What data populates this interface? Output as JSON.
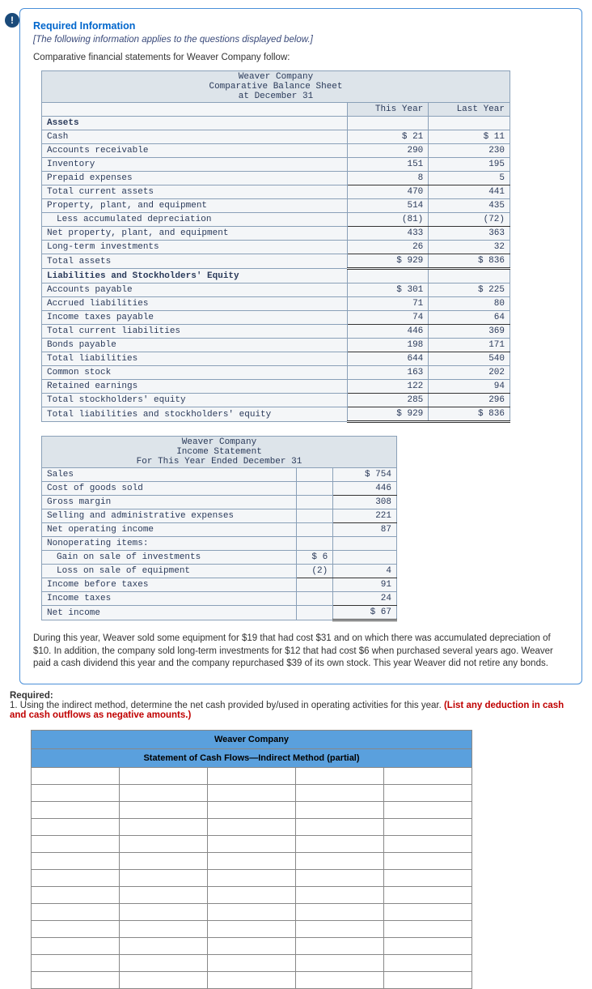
{
  "alert_glyph": "!",
  "card": {
    "heading": "Required Information",
    "note": "[The following information applies to the questions displayed below.]",
    "intro": "Comparative financial statements for Weaver Company follow:",
    "bs_header1": "Weaver Company",
    "bs_header2": "Comparative Balance Sheet",
    "bs_header3": "at December 31",
    "col_this": "This Year",
    "col_last": "Last Year",
    "bs_rows": [
      {
        "label": "Assets",
        "t": "",
        "l": "",
        "cls": "section"
      },
      {
        "label": "Cash",
        "t": "$ 21",
        "l": "$ 11"
      },
      {
        "label": "Accounts receivable",
        "t": "290",
        "l": "230"
      },
      {
        "label": "Inventory",
        "t": "151",
        "l": "195"
      },
      {
        "label": "Prepaid expenses",
        "t": "8",
        "l": "5",
        "cls": "underline"
      },
      {
        "label": "Total current assets",
        "t": "470",
        "l": "441"
      },
      {
        "label": "Property, plant, and equipment",
        "t": "514",
        "l": "435"
      },
      {
        "label": "Less accumulated depreciation",
        "t": "(81)",
        "l": "(72)",
        "indent": true,
        "cls": "underline"
      },
      {
        "label": "Net property, plant, and equipment",
        "t": "433",
        "l": "363"
      },
      {
        "label": "Long-term investments",
        "t": "26",
        "l": "32",
        "cls": "underline"
      },
      {
        "label": "Total assets",
        "t": "$ 929",
        "l": "$ 836",
        "cls": "dbl"
      },
      {
        "label": "Liabilities and Stockholders' Equity",
        "t": "",
        "l": "",
        "cls": "section"
      },
      {
        "label": "Accounts payable",
        "t": "$ 301",
        "l": "$ 225"
      },
      {
        "label": "Accrued liabilities",
        "t": "71",
        "l": "80"
      },
      {
        "label": "Income taxes payable",
        "t": "74",
        "l": "64",
        "cls": "underline"
      },
      {
        "label": "Total current liabilities",
        "t": "446",
        "l": "369"
      },
      {
        "label": "Bonds payable",
        "t": "198",
        "l": "171",
        "cls": "underline"
      },
      {
        "label": "Total liabilities",
        "t": "644",
        "l": "540"
      },
      {
        "label": "Common stock",
        "t": "163",
        "l": "202"
      },
      {
        "label": "Retained earnings",
        "t": "122",
        "l": "94",
        "cls": "underline"
      },
      {
        "label": "Total stockholders' equity",
        "t": "285",
        "l": "296",
        "cls": "underline"
      },
      {
        "label": "Total liabilities and stockholders' equity",
        "t": "$ 929",
        "l": "$ 836",
        "cls": "dbl"
      }
    ],
    "is_header1": "Weaver Company",
    "is_header2": "Income Statement",
    "is_header3": "For This Year Ended December 31",
    "is_rows": [
      {
        "label": "Sales",
        "p": "",
        "v": "$ 754"
      },
      {
        "label": "Cost of goods sold",
        "p": "",
        "v": "446",
        "cls": "underline"
      },
      {
        "label": "Gross margin",
        "p": "",
        "v": "308"
      },
      {
        "label": "Selling and administrative expenses",
        "p": "",
        "v": "221",
        "cls": "underline"
      },
      {
        "label": "Net operating income",
        "p": "",
        "v": "87"
      },
      {
        "label": "Nonoperating items:",
        "p": "",
        "v": ""
      },
      {
        "label": "Gain on sale of investments",
        "p": "$ 6",
        "v": "",
        "indent": true
      },
      {
        "label": "Loss on sale of equipment",
        "p": "(2)",
        "v": "4",
        "indent": true,
        "cls": "underline-pre"
      },
      {
        "label": "Income before taxes",
        "p": "",
        "v": "91"
      },
      {
        "label": "Income taxes",
        "p": "",
        "v": "24",
        "cls": "underline"
      },
      {
        "label": "Net income",
        "p": "",
        "v": "$ 67",
        "cls": "dbl"
      }
    ],
    "desc": "During this year, Weaver sold some equipment for $19 that had cost $31 and on which there was accumulated depreciation of $10. In addition, the company sold long-term investments for $12 that had cost $6 when purchased several years ago. Weaver paid a cash dividend this year and the company repurchased $39 of its own stock. This year Weaver did not retire any bonds."
  },
  "required": {
    "label": "Required:",
    "text_plain": "1. Using the indirect method, determine the net cash provided by/used in operating activities for this year. ",
    "text_red": "(List any deduction in cash and cash outflows as negative amounts.)"
  },
  "answer": {
    "title": "Weaver Company",
    "subtitle": "Statement of Cash Flows—Indirect Method (partial)",
    "blank_rows": 13
  }
}
